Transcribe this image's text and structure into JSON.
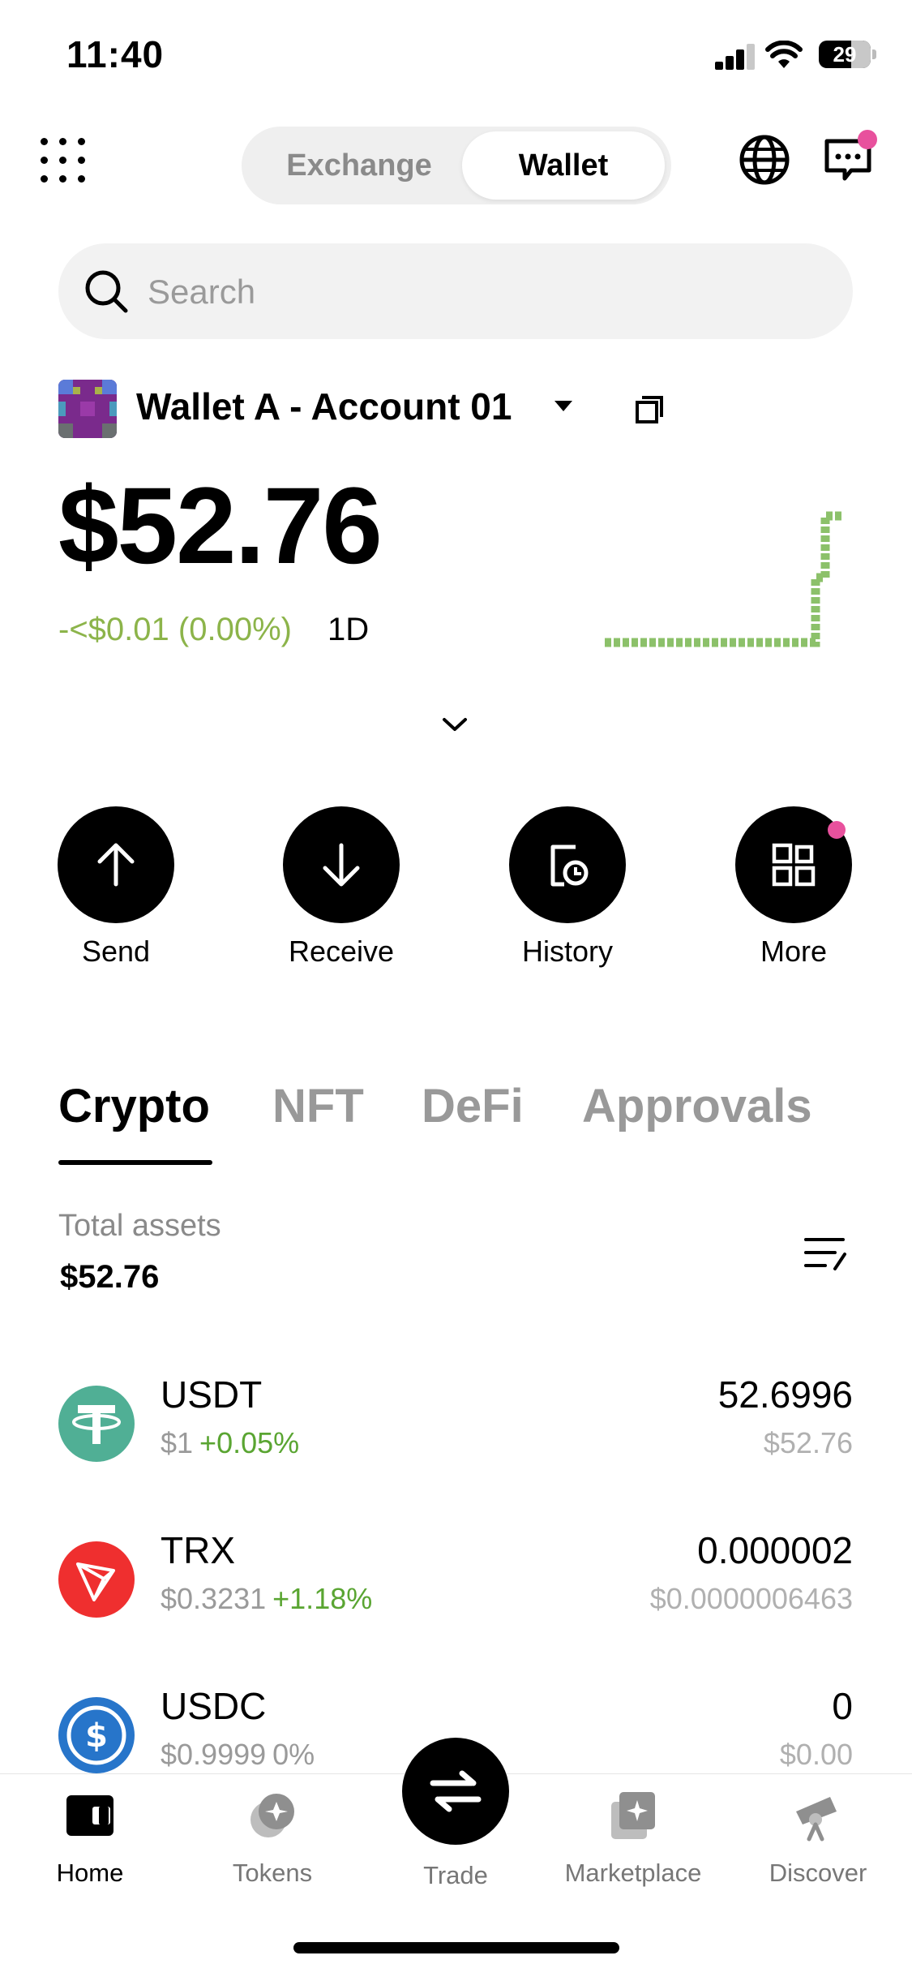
{
  "status_bar": {
    "time": "11:40",
    "battery": "29"
  },
  "header": {
    "segments": {
      "exchange": "Exchange",
      "wallet": "Wallet"
    },
    "active_segment": "Wallet",
    "icons": [
      "grid-menu-icon",
      "globe-icon",
      "chat-icon"
    ]
  },
  "search": {
    "placeholder": "Search"
  },
  "account": {
    "name": "Wallet A - Account 01",
    "balance": "$52.76",
    "change": "-<$0.01 (0.00%)",
    "period": "1D"
  },
  "actions": [
    {
      "label": "Send"
    },
    {
      "label": "Receive"
    },
    {
      "label": "History"
    },
    {
      "label": "More"
    }
  ],
  "tabs": [
    "Crypto",
    "NFT",
    "DeFi",
    "Approvals"
  ],
  "active_tab": "Crypto",
  "totals": {
    "label": "Total assets",
    "value": "$52.76"
  },
  "assets": [
    {
      "symbol": "USDT",
      "price": "$1",
      "change": "+0.05%",
      "amount": "52.6996",
      "value": "$52.76",
      "color": "#50af95"
    },
    {
      "symbol": "TRX",
      "price": "$0.3231",
      "change": "+1.18%",
      "amount": "0.000002",
      "value": "$0.0000006463",
      "color": "#ef2f2f"
    },
    {
      "symbol": "USDC",
      "price": "$0.9999",
      "change": "0%",
      "amount": "0",
      "value": "$0.00",
      "color": "#2775ca"
    }
  ],
  "nav": [
    {
      "label": "Home"
    },
    {
      "label": "Tokens"
    },
    {
      "label": "Trade"
    },
    {
      "label": "Marketplace"
    },
    {
      "label": "Discover"
    }
  ],
  "colors": {
    "accent_pink": "#e8519d",
    "positive": "#5aa532",
    "sparkline": "#8cc16a"
  }
}
